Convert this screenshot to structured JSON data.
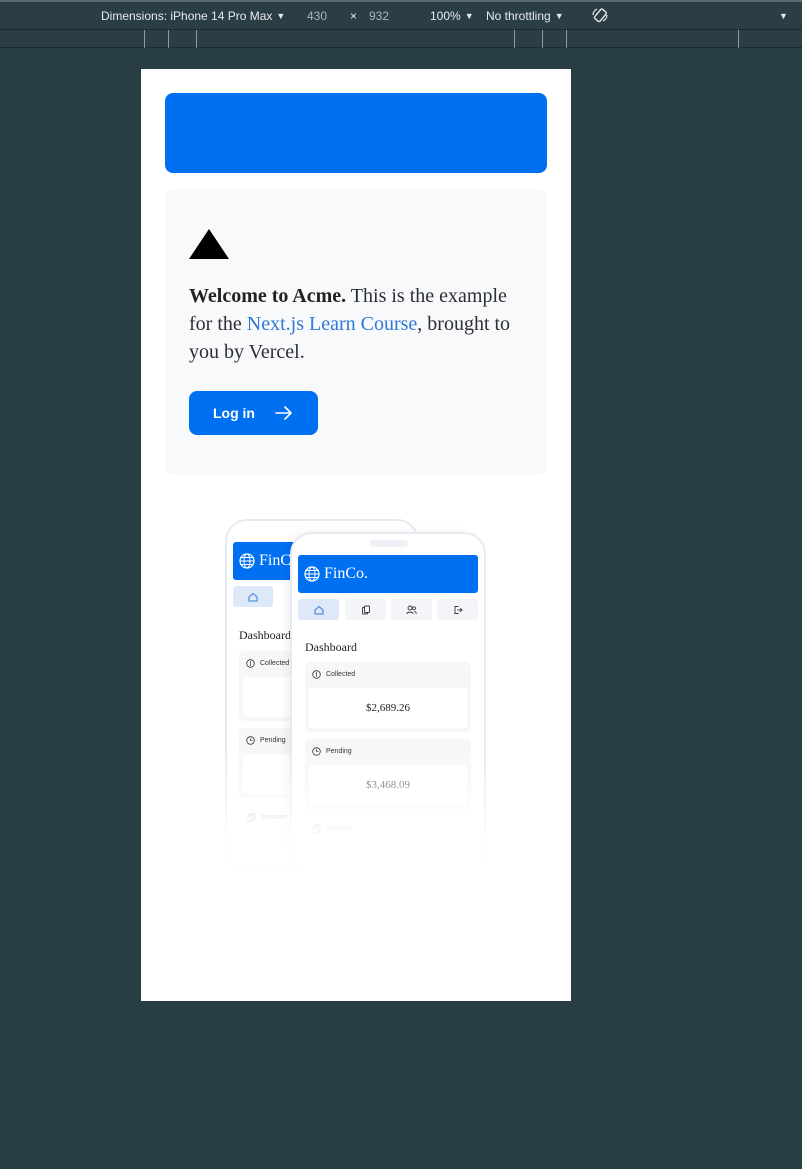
{
  "devtools": {
    "dimensions_label": "Dimensions: iPhone 14 Pro Max",
    "width": "430",
    "times": "×",
    "height": "932",
    "zoom": "100%",
    "throttling": "No throttling"
  },
  "card": {
    "welcome_bold": "Welcome to Acme.",
    "welcome_text1": " This is the example for the ",
    "link_text": "Next.js Learn Course",
    "welcome_text2": ", brought to you by Vercel.",
    "login_label": "Log in"
  },
  "hero": {
    "back_phone": {
      "brand": "FinCo.",
      "title": "Dashboard",
      "collected_label": "Collected",
      "pending_label": "Pending",
      "invoices_label": "Invoices"
    },
    "front_phone": {
      "brand": "FinCo.",
      "title": "Dashboard",
      "collected_label": "Collected",
      "collected_value": "$2,689.26",
      "pending_label": "Pending",
      "pending_value": "$3,468.09",
      "invoices_label": "Invoices"
    }
  },
  "colors": {
    "brand_blue": "#0070f3",
    "link_blue": "#2f7ad9",
    "card_bg": "#f8f9fb",
    "page_bg": "#283d44"
  }
}
